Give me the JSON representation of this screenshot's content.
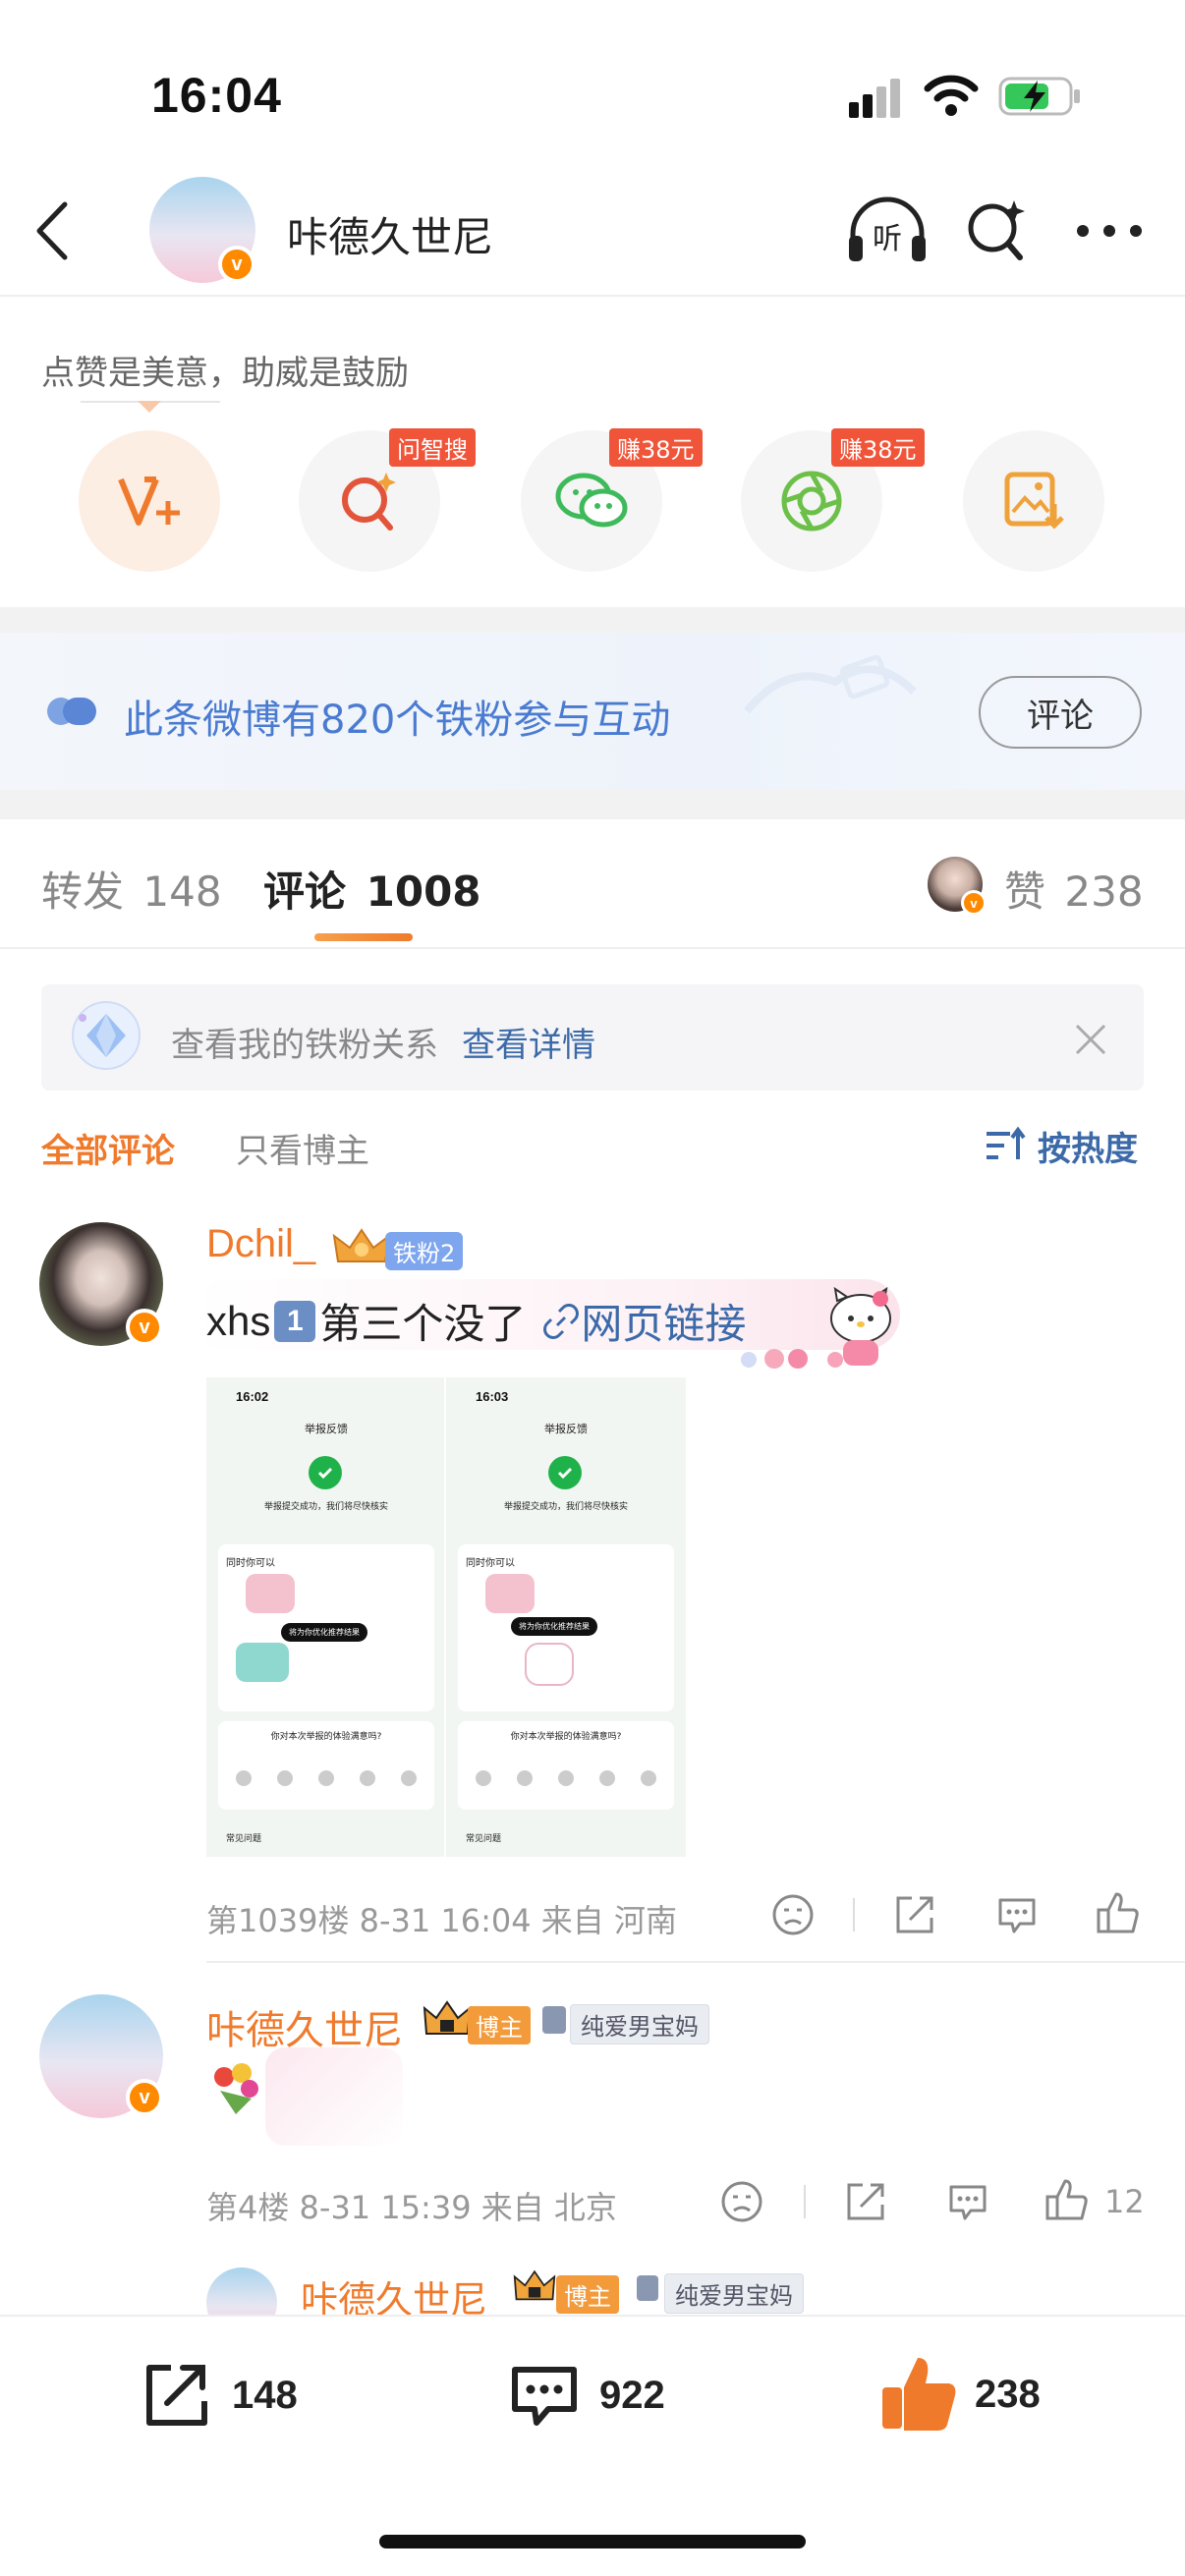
{
  "status_bar": {
    "time": "16:04"
  },
  "header": {
    "title": "咔德久世尼",
    "listen_label": "听"
  },
  "support": {
    "prompt": "点赞是美意，助威是鼓励",
    "actions": [
      {
        "name": "vplus",
        "tag": ""
      },
      {
        "name": "wenzhisou",
        "tag": "问智搜"
      },
      {
        "name": "wechat",
        "tag": "赚38元"
      },
      {
        "name": "moments",
        "tag": "赚38元"
      },
      {
        "name": "save-image",
        "tag": ""
      }
    ]
  },
  "fans_banner": {
    "text": "此条微博有820个铁粉参与互动",
    "button": "评论"
  },
  "tabs": {
    "repost_label": "转发",
    "repost_count": "148",
    "comment_label": "评论",
    "comment_count": "1008",
    "like_label": "赞",
    "like_count": "238"
  },
  "fan_notice": {
    "text": "查看我的铁粉关系",
    "link": "查看详情"
  },
  "filter": {
    "all": "全部评论",
    "blogger_only": "只看博主",
    "sort": "按热度"
  },
  "comments": [
    {
      "username": "Dchil_",
      "fan_badge": "铁粉2",
      "text_prefix": "xhs",
      "number_emoji": "1",
      "text_main": "第三个没了",
      "link_label": "网页链接",
      "meta": "第1039楼 8-31 16:04 来自 河南",
      "screenshots": [
        {
          "time": "16:02",
          "title": "举报反馈",
          "success": "举报提交成功，我们将尽快核实",
          "section": "同时你可以",
          "toast": "将为你优化推荐结果",
          "survey": "你对本次举报的体验满意吗?",
          "faq": "常见问题"
        },
        {
          "time": "16:03",
          "title": "举报反馈",
          "success": "举报提交成功，我们将尽快核实",
          "section": "同时你可以",
          "toast": "将为你优化推荐结果",
          "survey": "你对本次举报的体验满意吗?",
          "faq": "常见问题"
        }
      ]
    },
    {
      "username": "咔德久世尼",
      "role_badge": "博主",
      "fan_group": "纯爱男宝妈",
      "meta": "第4楼 8-31 15:39 来自 北京",
      "like_count": "12"
    }
  ],
  "reply_preview": {
    "username": "咔德久世尼",
    "role_badge": "博主",
    "fan_group": "纯爱男宝妈"
  },
  "bottom_bar": {
    "repost": "148",
    "comment": "922",
    "like": "238"
  },
  "colors": {
    "accent_orange": "#f07a2c",
    "link_blue": "#3c6aa8",
    "tag_red": "#f0553a"
  }
}
